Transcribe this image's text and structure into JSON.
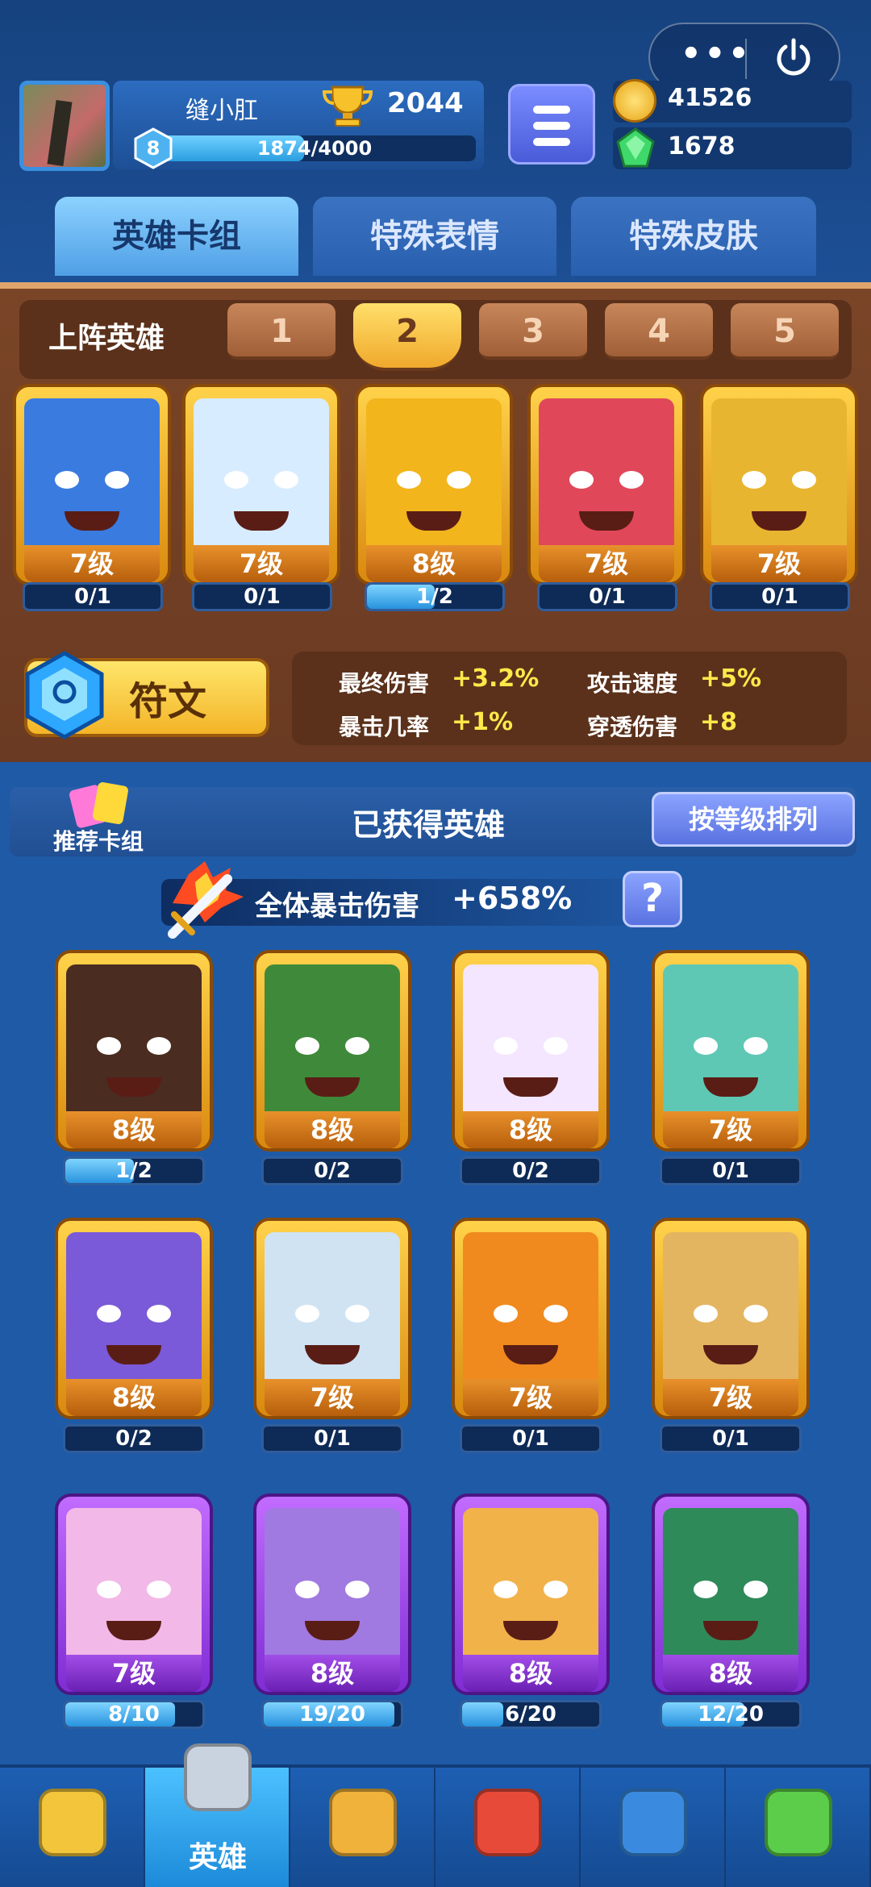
{
  "header": {
    "username": "缝小肛",
    "trophies": "2044",
    "level": "8",
    "xp_text": "1874/4000",
    "xp_progress": 0.4685,
    "gold": "41526",
    "gems": "1678"
  },
  "system": {
    "more_icon": "more-dots-icon",
    "power_icon": "power-icon"
  },
  "tabs": [
    {
      "label": "英雄卡组"
    },
    {
      "label": "特殊表情"
    },
    {
      "label": "特殊皮肤"
    }
  ],
  "deck": {
    "label": "上阵英雄",
    "numbers": [
      "1",
      "2",
      "3",
      "4",
      "5"
    ],
    "selected": "2",
    "cards": [
      {
        "level": "7级",
        "progress": "0/1",
        "fraction": 0,
        "color": "#3a7be0"
      },
      {
        "level": "7级",
        "progress": "0/1",
        "fraction": 0,
        "color": "#d8ecff"
      },
      {
        "level": "8级",
        "progress": "1/2",
        "fraction": 0.5,
        "color": "#f2b51c"
      },
      {
        "level": "7级",
        "progress": "0/1",
        "fraction": 0,
        "color": "#e0485a"
      },
      {
        "level": "7级",
        "progress": "0/1",
        "fraction": 0,
        "color": "#e8b530"
      }
    ]
  },
  "runes": {
    "button_label": "符文",
    "stats": [
      {
        "name": "最终伤害",
        "value": "+3.2%"
      },
      {
        "name": "攻击速度",
        "value": "+5%"
      },
      {
        "name": "暴击几率",
        "value": "+1%"
      },
      {
        "name": "穿透伤害",
        "value": "+8"
      }
    ]
  },
  "collection": {
    "recommend_label": "推荐卡组",
    "title": "已获得英雄",
    "sort_label": "按等级排列",
    "crit_label": "全体暴击伤害",
    "crit_value": "+658%",
    "help": "?",
    "cards": [
      {
        "level": "8级",
        "progress": "1/2",
        "fraction": 0.5,
        "color": "#4a2c20",
        "rarity": "legend"
      },
      {
        "level": "8级",
        "progress": "0/2",
        "fraction": 0,
        "color": "#3f8a3a",
        "rarity": "legend"
      },
      {
        "level": "8级",
        "progress": "0/2",
        "fraction": 0,
        "color": "#f4e6ff",
        "rarity": "legend"
      },
      {
        "level": "7级",
        "progress": "0/1",
        "fraction": 0,
        "color": "#5fc8b5",
        "rarity": "legend"
      },
      {
        "level": "8级",
        "progress": "0/2",
        "fraction": 0,
        "color": "#7a5ad8",
        "rarity": "legend"
      },
      {
        "level": "7级",
        "progress": "0/1",
        "fraction": 0,
        "color": "#cfe3f3",
        "rarity": "legend"
      },
      {
        "level": "7级",
        "progress": "0/1",
        "fraction": 0,
        "color": "#f08a1e",
        "rarity": "legend"
      },
      {
        "level": "7级",
        "progress": "0/1",
        "fraction": 0,
        "color": "#e3b560",
        "rarity": "legend"
      },
      {
        "level": "7级",
        "progress": "8/10",
        "fraction": 0.8,
        "color": "#f2b8e8",
        "rarity": "epic"
      },
      {
        "level": "8级",
        "progress": "19/20",
        "fraction": 0.95,
        "color": "#a07ae0",
        "rarity": "epic"
      },
      {
        "level": "8级",
        "progress": "6/20",
        "fraction": 0.3,
        "color": "#f2b24a",
        "rarity": "epic"
      },
      {
        "level": "8级",
        "progress": "12/20",
        "fraction": 0.6,
        "color": "#2f8a5a",
        "rarity": "epic"
      }
    ]
  },
  "nav": {
    "items": [
      {
        "icon": "treasure-chest-icon",
        "label": ""
      },
      {
        "icon": "knight-helmet-icon",
        "label": "英雄"
      },
      {
        "icon": "crossed-swords-icon",
        "label": ""
      },
      {
        "icon": "crown-shield-icon",
        "label": ""
      },
      {
        "icon": "team-flag-icon",
        "label": ""
      },
      {
        "icon": "sprout-island-icon",
        "label": ""
      }
    ],
    "active": 1
  }
}
